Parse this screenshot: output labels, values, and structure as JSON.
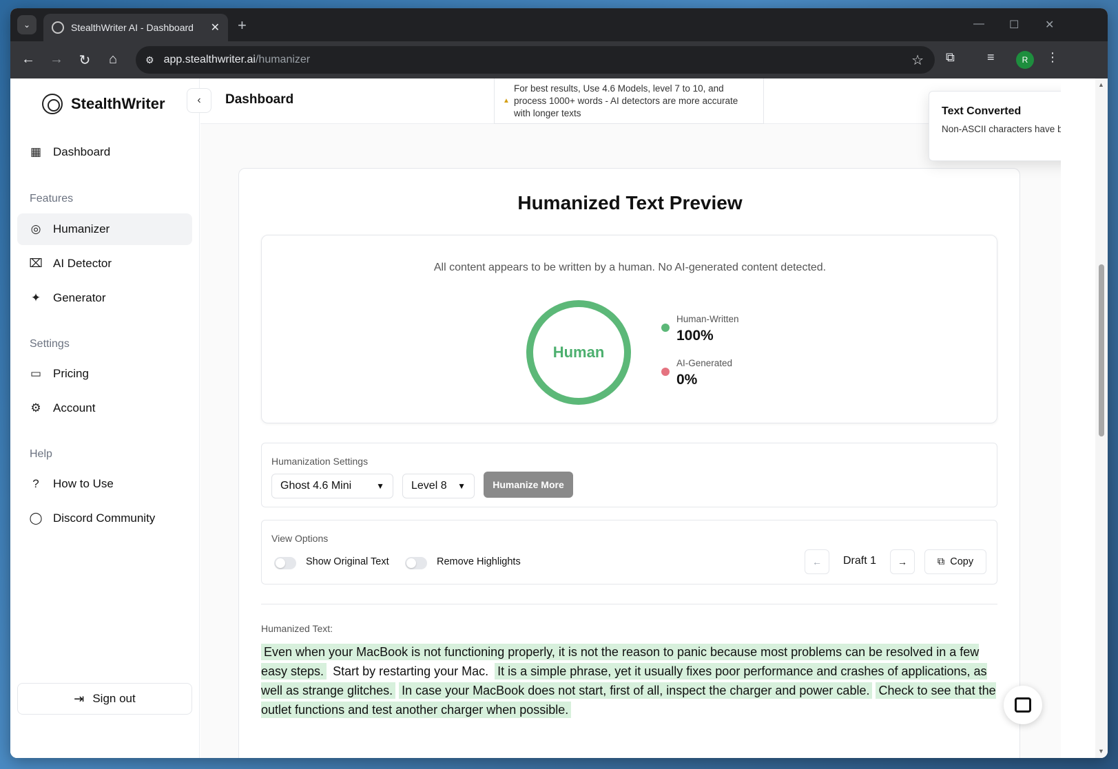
{
  "browser": {
    "tab_title": "StealthWriter AI - Dashboard",
    "url_host": "app.stealthwriter.ai",
    "url_path": "/humanizer",
    "profile_initial": "R"
  },
  "sidebar": {
    "brand": "StealthWriter",
    "items": {
      "dashboard": "Dashboard",
      "features_heading": "Features",
      "humanizer": "Humanizer",
      "ai_detector": "AI Detector",
      "generator": "Generator",
      "settings_heading": "Settings",
      "pricing": "Pricing",
      "account": "Account",
      "help_heading": "Help",
      "how_to_use": "How to Use",
      "discord": "Discord Community"
    },
    "sign_out": "Sign out"
  },
  "header": {
    "title": "Dashboard",
    "tip": "For best results, Use 4.6 Models, level 7 to 10, and process 1000+ words - AI detectors are more accurate with longer texts"
  },
  "toast": {
    "title": "Text Converted",
    "description": "Non-ASCII characters have been converted to ASCII equivalents."
  },
  "preview": {
    "title": "Humanized Text Preview",
    "message": "All content appears to be written by a human. No AI-generated content detected.",
    "donut_label": "Human",
    "human_label": "Human-Written",
    "human_value": "100%",
    "ai_label": "AI-Generated",
    "ai_value": "0%",
    "colors": {
      "human": "#5cb878",
      "ai": "#e57380"
    }
  },
  "settings": {
    "label": "Humanization Settings",
    "model": "Ghost 4.6 Mini",
    "level": "Level 8",
    "humanize_button": "Humanize More"
  },
  "view_options": {
    "label": "View Options",
    "show_original": "Show Original Text",
    "remove_highlights": "Remove Highlights",
    "draft": "Draft 1",
    "copy": "Copy"
  },
  "humanized": {
    "label": "Humanized Text:",
    "sentences": [
      "Even when your MacBook is not functioning properly, it is not the reason to panic because most problems can be resolved in a few easy steps.",
      "Start by restarting your Mac.",
      "It is a simple phrase, yet it usually fixes poor performance and crashes of applications, as well as strange glitches.",
      "In case your MacBook does not start, first of all, inspect the charger and power cable.",
      "Check to see that the outlet functions and test another charger when possible."
    ]
  }
}
